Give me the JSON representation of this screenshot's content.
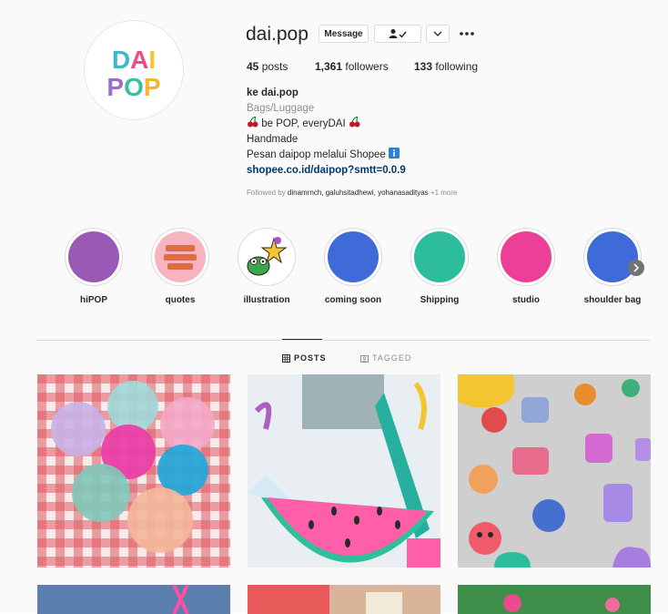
{
  "profile": {
    "username": "dai.pop",
    "message_label": "Message",
    "follow_icon": "person-check-icon",
    "dropdown_icon": "chevron-down-icon",
    "more_icon": "ellipsis-icon",
    "stats": {
      "posts_count": "45",
      "posts_label": "posts",
      "followers_count": "1,361",
      "followers_label": "followers",
      "following_count": "133",
      "following_label": "following"
    },
    "bio": {
      "name": "ke dai.pop",
      "category": "Bags/Luggage",
      "line1": "be POP, everyDAI",
      "line2": "Handmade",
      "line3": "Pesan daipop melalui Shopee",
      "link": "shopee.co.id/daipop?smtt=0.0.9"
    },
    "followed_by_prefix": "Followed by",
    "followed_by_names": "dinamrnch, galuhsitadhewi, yohanasadityas",
    "followed_by_more": "+1 more",
    "avatar_text_top": "DAI",
    "avatar_text_bottom": "POP"
  },
  "highlights": [
    {
      "label": "hiPOP",
      "color": "#9b59b6"
    },
    {
      "label": "quotes",
      "color": "#f8b3c0"
    },
    {
      "label": "illustration",
      "color": "#ffffff"
    },
    {
      "label": "coming soon",
      "color": "#3f6bd8"
    },
    {
      "label": "Shipping",
      "color": "#2ebd9c"
    },
    {
      "label": "studio",
      "color": "#ec3f97"
    },
    {
      "label": "shoulder bag",
      "color": "#3f6bd8"
    }
  ],
  "tabs": {
    "posts": "POSTS",
    "tagged": "TAGGED"
  },
  "colors": {
    "link": "#00376b",
    "muted": "#8e8e8e",
    "border": "#dbdbdb"
  }
}
